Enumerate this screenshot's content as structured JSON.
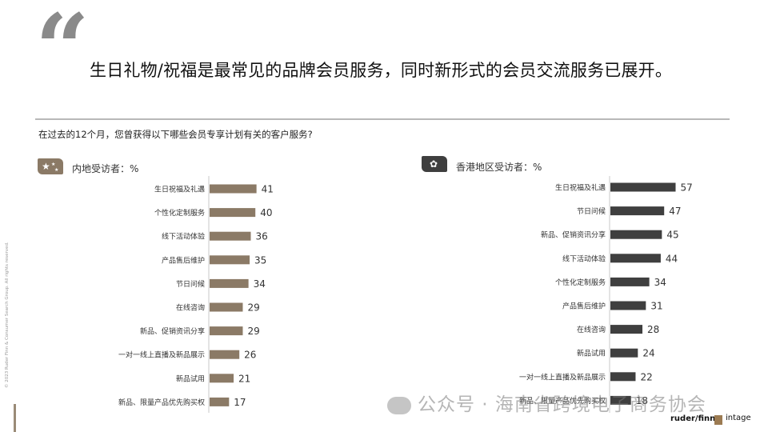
{
  "quote_mark": "“",
  "headline": "生日礼物/祝福是最常见的品牌会员服务，同时新形式的会员交流服务已展开。",
  "question": "在过去的12个月，您曾获得以下哪些会员专享计划有关的客户服务?",
  "side_label": "© 2023 Ruder Finn & Consumer Search Group. All rights reserved.",
  "watermark": "公众号 · 海南省跨境电子商务协会",
  "logos": {
    "ruder": "ruder/finn",
    "intage": "intage"
  },
  "colors": {
    "mainland": "#8b7a66",
    "hongkong": "#3f3f3f"
  },
  "chart_data": [
    {
      "type": "bar",
      "orientation": "horizontal",
      "title": "内地受访者：%",
      "categories": [
        "生日祝福及礼遇",
        "个性化定制服务",
        "线下活动体验",
        "产品售后维护",
        "节日问候",
        "在线咨询",
        "新品、促销资讯分享",
        "一对一线上直播及新品展示",
        "新品试用",
        "新品、限量产品优先购买权"
      ],
      "values": [
        41,
        40,
        36,
        35,
        34,
        29,
        29,
        26,
        21,
        17
      ],
      "xlim": [
        0,
        60
      ]
    },
    {
      "type": "bar",
      "orientation": "horizontal",
      "title": "香港地区受访者：%",
      "categories": [
        "生日祝福及礼遇",
        "节日问候",
        "新品、促销资讯分享",
        "线下活动体验",
        "个性化定制服务",
        "产品售后维护",
        "在线咨询",
        "新品试用",
        "一对一线上直播及新品展示",
        "新品、限量产品优先购买权"
      ],
      "values": [
        57,
        47,
        45,
        44,
        34,
        31,
        28,
        24,
        22,
        18
      ],
      "xlim": [
        0,
        60
      ]
    }
  ]
}
